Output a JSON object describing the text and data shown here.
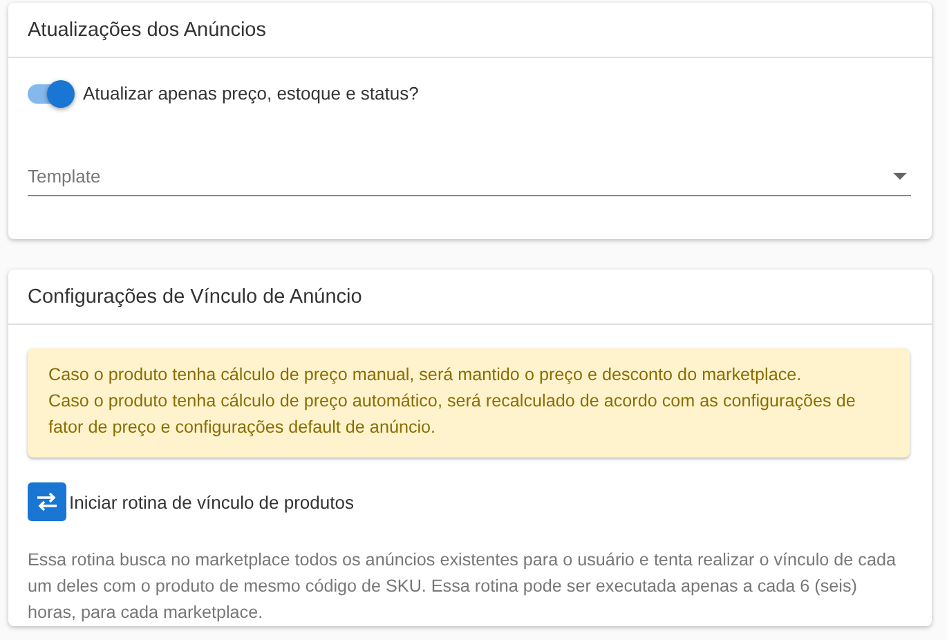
{
  "update_card": {
    "title": "Atualizações dos Anúncios",
    "switch": {
      "label": "Atualizar apenas preço, estoque e status?",
      "on": true
    },
    "template_select": {
      "placeholder": "Template"
    }
  },
  "link_card": {
    "title": "Configurações de Vínculo de Anúncio",
    "alert": [
      "Caso o produto tenha cálculo de preço manual, será mantido o preço e desconto do marketplace.",
      "Caso o produto tenha cálculo de preço automático, será recalculado de acordo com as configurações de fator de preço e configurações default de anúncio."
    ],
    "action": {
      "label": "Iniciar rotina de vínculo de produtos"
    },
    "description": "Essa rotina busca no marketplace todos os anúncios existentes para o usuário e tenta realizar o vínculo de cada um deles com o produto de mesmo código de SKU. Essa rotina pode ser executada apenas a cada 6 (seis) horas, para cada marketplace."
  }
}
